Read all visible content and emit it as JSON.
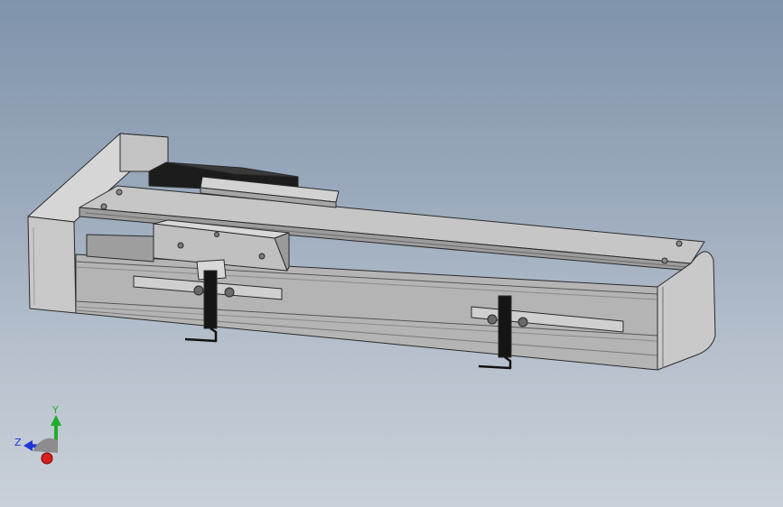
{
  "viewport": {
    "background_top": "#7f93ab",
    "background_bottom": "#c9d0d9"
  },
  "model": {
    "type": "linear-actuator-stage",
    "body_color": "#b9b9b9",
    "edge_color": "#2a2a2a",
    "motor_color": "#1c1c1c"
  },
  "triad": {
    "y_label": "Y",
    "z_label": "Z",
    "x_color": "#d62020",
    "y_color": "#1fae2a",
    "z_color": "#2035d6"
  }
}
